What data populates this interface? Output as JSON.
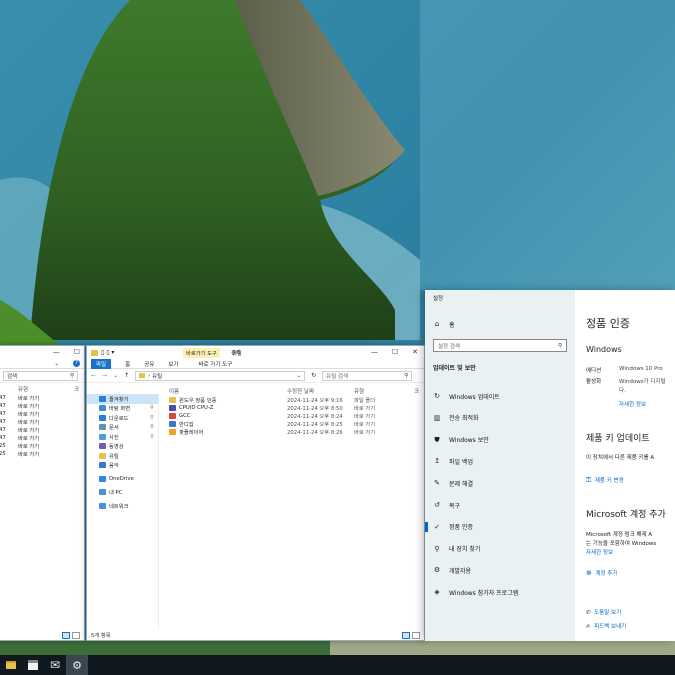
{
  "explorer_left": {
    "search_placeholder": "검색",
    "col_type": "유형",
    "col_size": "크",
    "rows": [
      {
        "time": "47",
        "type": "바로 가기"
      },
      {
        "time": "47",
        "type": "바로 가기"
      },
      {
        "time": "47",
        "type": "바로 가기"
      },
      {
        "time": "47",
        "type": "바로 가기"
      },
      {
        "time": "47",
        "type": "바로 가기"
      },
      {
        "time": "47",
        "type": "바로 가기"
      },
      {
        "time": "25",
        "type": "바로 가기"
      },
      {
        "time": "25",
        "type": "바로 가기"
      }
    ]
  },
  "explorer_main": {
    "title": "유틸",
    "context_tab": "바로가기 도구",
    "ribbon_context": "관리",
    "ribbon": {
      "file": "파일",
      "home": "홈",
      "share": "공유",
      "view": "보기",
      "tools": "바로 가기 도구"
    },
    "address": "유틸",
    "search_placeholder": "유틸 검색",
    "columns": {
      "name": "이름",
      "modified": "수정한 날짜",
      "type": "유형",
      "size": "크"
    },
    "files": [
      {
        "name": "윈도우 정품 인증",
        "date": "2024-11-24 오후 9:16",
        "type": "파일 폴더"
      },
      {
        "name": "CPUID CPU-Z",
        "date": "2024-11-24 오후 8:50",
        "type": "바로 가기"
      },
      {
        "name": "GCC",
        "date": "2024-11-24 오후 8:24",
        "type": "바로 가기"
      },
      {
        "name": "반디집",
        "date": "2024-11-24 오후 8:25",
        "type": "바로 가기"
      },
      {
        "name": "팟플레이어",
        "date": "2024-11-24 오후 8:26",
        "type": "바로 가기"
      }
    ],
    "nav": [
      {
        "label": "즐겨찾기",
        "color": "#2a7fd4",
        "selected": true
      },
      {
        "label": "바탕 화면",
        "color": "#3b8fe0"
      },
      {
        "label": "다운로드",
        "color": "#2a7fd4"
      },
      {
        "label": "문서",
        "color": "#6d8fb4"
      },
      {
        "label": "사진",
        "color": "#4aa0d8"
      },
      {
        "label": "동영상",
        "color": "#7a5bb0"
      },
      {
        "label": "유틸",
        "color": "#e8c14a"
      },
      {
        "label": "음악",
        "color": "#3a78c8"
      },
      {
        "label": "OneDrive",
        "color": "#2a8ae0"
      },
      {
        "label": "내 PC",
        "color": "#4a90d8"
      },
      {
        "label": "네트워크",
        "color": "#4a90d8"
      }
    ],
    "status": "5개 항목"
  },
  "settings": {
    "app_title": "설정",
    "home": "홈",
    "search_placeholder": "설정 검색",
    "section": "업데이트 및 보안",
    "items": [
      {
        "icon": "↻",
        "label": "Windows 업데이트"
      },
      {
        "icon": "▥",
        "label": "전송 최적화"
      },
      {
        "icon": "⛊",
        "label": "Windows 보안"
      },
      {
        "icon": "↥",
        "label": "파일 백업"
      },
      {
        "icon": "✎",
        "label": "문제 해결"
      },
      {
        "icon": "↺",
        "label": "복구"
      },
      {
        "icon": "✓",
        "label": "정품 인증",
        "selected": true
      },
      {
        "icon": "⚲",
        "label": "내 장치 찾기"
      },
      {
        "icon": "⚙",
        "label": "개발자용"
      },
      {
        "icon": "◈",
        "label": "Windows 참가자 프로그램"
      }
    ],
    "page_title": "정품 인증",
    "windows_heading": "Windows",
    "edition_label": "에디션",
    "edition_value": "Windows 10 Pro",
    "activation_label": "활성화",
    "activation_value_1": "Windows가 디지털",
    "activation_value_2": "다.",
    "more_info": "자세한 정보",
    "product_key_heading": "제품 키 업데이트",
    "product_key_desc": "이 장치에서 다른 제품 키를 A",
    "change_key": "제품 키 변경",
    "ms_account_heading": "Microsoft 계정 추가",
    "ms_account_desc_1": "Microsoft 계정 링크 해제 A",
    "ms_account_desc_2": "는 기능을 포함하여 Windows",
    "ms_more_info": "자세한 정보",
    "add_account": "계정 추가",
    "help": "도움말 보기",
    "feedback": "피드백 보내기",
    "accent": "#0067c0"
  },
  "taskbar": {
    "icons": [
      "explorer-icon",
      "store-icon",
      "mail-icon",
      "settings-icon"
    ]
  }
}
